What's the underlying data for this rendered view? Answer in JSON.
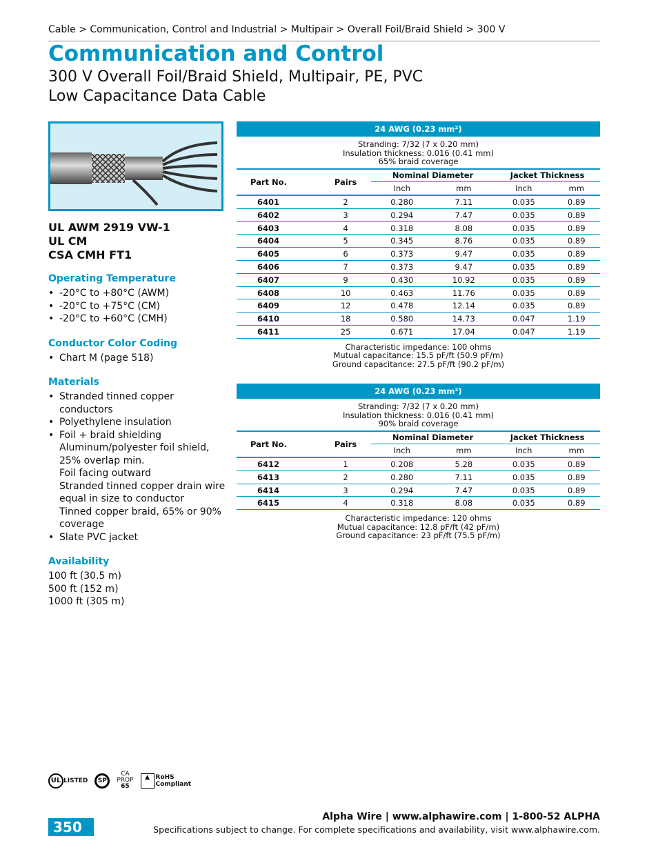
{
  "breadcrumb": "Cable > Communication, Control and Industrial > Multipair > Overall Foil/Braid Shield > 300 V",
  "title": "Communication and Control",
  "subtitle1": "300 V Overall Foil/Braid Shield, Multipair, PE, PVC",
  "subtitle2": "Low Capacitance Data Cable",
  "certs": [
    "UL AWM 2919 VW-1",
    "UL CM",
    "CSA CMH FT1"
  ],
  "op_temp": {
    "heading": "Operating Temperature",
    "items": [
      "-20°C to +80°C (AWM)",
      "-20°C to +75°C (CM)",
      "-20°C to +60°C (CMH)"
    ]
  },
  "color": {
    "heading": "Conductor Color Coding",
    "items": [
      "Chart M (page 518)"
    ]
  },
  "materials": {
    "heading": "Materials",
    "items": [
      {
        "t": "Stranded tinned copper conductors",
        "b": true
      },
      {
        "t": "Polyethylene insulation",
        "b": true
      },
      {
        "t": "Foil + braid shielding",
        "b": true
      },
      {
        "t": "Aluminum/polyester foil shield, 25% overlap min.",
        "b": false
      },
      {
        "t": "Foil facing outward",
        "b": false
      },
      {
        "t": "Stranded tinned copper drain wire equal in size to conductor",
        "b": false
      },
      {
        "t": "Tinned copper braid, 65% or 90% coverage",
        "b": false
      },
      {
        "t": "Slate PVC jacket",
        "b": true
      }
    ]
  },
  "availability": {
    "heading": "Availability",
    "items": [
      "100 ft (30.5 m)",
      "500 ft (152 m)",
      "1000 ft (305 m)"
    ]
  },
  "headers": {
    "part": "Part No.",
    "pairs": "Pairs",
    "nd": "Nominal Diameter",
    "jt": "Jacket Thickness",
    "inch": "Inch",
    "mm": "mm"
  },
  "tables": [
    {
      "bar": "24 AWG (0.23 mm²)",
      "info": [
        "Stranding: 7/32 (7 x 0.20 mm)",
        "Insulation thickness: 0.016 (0.41 mm)",
        "65% braid coverage"
      ],
      "rows": [
        [
          "6401",
          "2",
          "0.280",
          "7.11",
          "0.035",
          "0.89"
        ],
        [
          "6402",
          "3",
          "0.294",
          "7.47",
          "0.035",
          "0.89"
        ],
        [
          "6403",
          "4",
          "0.318",
          "8.08",
          "0.035",
          "0.89"
        ],
        [
          "6404",
          "5",
          "0.345",
          "8.76",
          "0.035",
          "0.89"
        ],
        [
          "6405",
          "6",
          "0.373",
          "9.47",
          "0.035",
          "0.89"
        ],
        [
          "6406",
          "7",
          "0.373",
          "9.47",
          "0.035",
          "0.89"
        ],
        [
          "6407",
          "9",
          "0.430",
          "10.92",
          "0.035",
          "0.89"
        ],
        [
          "6408",
          "10",
          "0.463",
          "11.76",
          "0.035",
          "0.89"
        ],
        [
          "6409",
          "12",
          "0.478",
          "12.14",
          "0.035",
          "0.89"
        ],
        [
          "6410",
          "18",
          "0.580",
          "14.73",
          "0.047",
          "1.19"
        ],
        [
          "6411",
          "25",
          "0.671",
          "17.04",
          "0.047",
          "1.19"
        ]
      ],
      "foot": [
        "Characteristic impedance: 100 ohms",
        "Mutual capacitance: 15.5 pF/ft (50.9 pF/m)",
        "Ground capacitance: 27.5 pF/ft (90.2 pF/m)"
      ]
    },
    {
      "bar": "24 AWG (0.23 mm²)",
      "info": [
        "Stranding: 7/32 (7 x 0.20 mm)",
        "Insulation thickness: 0.016 (0.41 mm)",
        "90% braid coverage"
      ],
      "rows": [
        [
          "6412",
          "1",
          "0.208",
          "5.28",
          "0.035",
          "0.89"
        ],
        [
          "6413",
          "2",
          "0.280",
          "7.11",
          "0.035",
          "0.89"
        ],
        [
          "6414",
          "3",
          "0.294",
          "7.47",
          "0.035",
          "0.89"
        ],
        [
          "6415",
          "4",
          "0.318",
          "8.08",
          "0.035",
          "0.89"
        ]
      ],
      "foot": [
        "Characteristic impedance: 120 ohms",
        "Mutual capacitance: 12.8 pF/ft (42 pF/m)",
        "Ground capacitance: 23 pF/ft (75.5 pF/m)"
      ]
    }
  ],
  "logos": {
    "ul": "UL LISTED",
    "csa": "SP",
    "prop65": "CA PROP 65",
    "rohs": "RoHS Compliant"
  },
  "page_number": "350",
  "footer1": "Alpha Wire | www.alphawire.com | 1-800-52 ALPHA",
  "footer2": "Specifications subject to change. For complete specifications and availability, visit www.alphawire.com.",
  "accent": "#0097c6"
}
